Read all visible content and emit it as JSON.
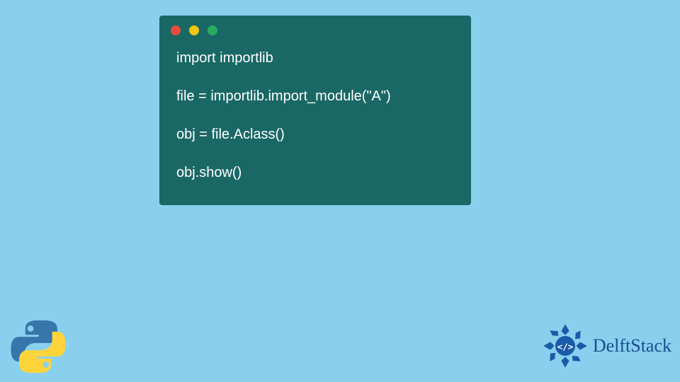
{
  "code": {
    "line1": "import importlib",
    "line2": "file = importlib.import_module(\"A\")",
    "line3": "obj = file.Aclass()",
    "line4": "obj.show()"
  },
  "branding": {
    "delft_text": "DelftStack"
  },
  "colors": {
    "background": "#88d0ee",
    "window": "#1a6866",
    "delft_blue": "#1a4d8f"
  }
}
